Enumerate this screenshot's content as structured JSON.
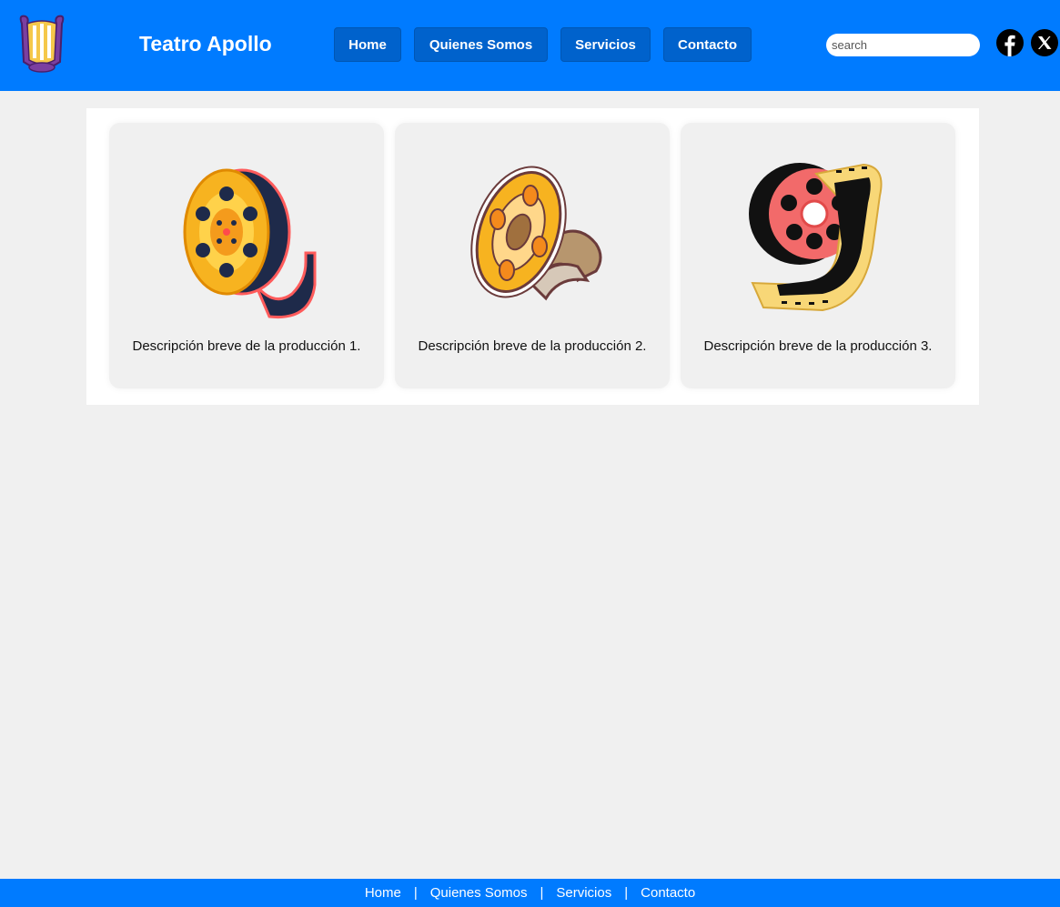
{
  "header": {
    "brand": "Teatro Apollo",
    "logo_icon": "lyre-icon",
    "nav": [
      {
        "label": "Home"
      },
      {
        "label": "Quienes Somos"
      },
      {
        "label": "Servicios"
      },
      {
        "label": "Contacto"
      }
    ],
    "search": {
      "placeholder": "search",
      "value": ""
    },
    "social": [
      "facebook-icon",
      "x-icon"
    ]
  },
  "cards": [
    {
      "icon": "film-reel-icon",
      "description": "Descripción breve de la producción 1."
    },
    {
      "icon": "film-reel-icon",
      "description": "Descripción breve de la producción 2."
    },
    {
      "icon": "film-reel-icon",
      "description": "Descripción breve de la producción 3."
    }
  ],
  "footer": {
    "links": [
      "Home",
      "Quienes Somos",
      "Servicios",
      "Contacto"
    ],
    "separator": "|"
  },
  "colors": {
    "primary": "#007bff",
    "nav_button": "#0062cc",
    "page_bg": "#f0f0f0"
  }
}
